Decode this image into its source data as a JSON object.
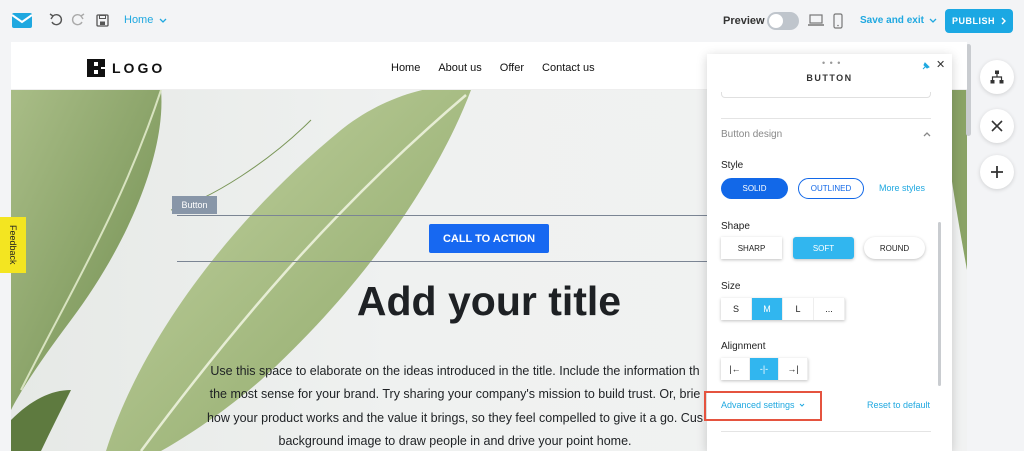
{
  "toolbar": {
    "page_selector": "Home",
    "preview_label": "Preview",
    "save_exit_label": "Save and exit",
    "publish_label": "PUBLISH"
  },
  "site": {
    "logo_text": "LOGO",
    "nav": [
      "Home",
      "About us",
      "Offer",
      "Contact us"
    ],
    "selected_tag": "Button",
    "cta_label": "CALL TO ACTION",
    "title": "Add your title",
    "body_lines": [
      "Use this space to elaborate on the ideas introduced in the title. Include the information th",
      "the most sense for your brand. Try sharing your company's mission to build trust. Or, brie",
      "how your product works and the value it brings, so they feel compelled to give it a go. Cus",
      "background image to draw people in and drive your point home."
    ]
  },
  "feedback_label": "Feedback",
  "panel": {
    "drag_handle": "• • •",
    "title": "BUTTON",
    "section_title": "Button design",
    "style_label": "Style",
    "style_options": [
      "SOLID",
      "OUTLINED"
    ],
    "more_styles": "More styles",
    "shape_label": "Shape",
    "shape_options": [
      "SHARP",
      "SOFT",
      "ROUND"
    ],
    "size_label": "Size",
    "size_options": [
      "S",
      "M",
      "L",
      "..."
    ],
    "alignment_label": "Alignment",
    "alignment_options": [
      "|←",
      "-|-",
      "→|"
    ],
    "advanced_settings": "Advanced settings",
    "reset_default": "Reset to default"
  },
  "colors": {
    "accent": "#1fa8e0",
    "cta_blue": "#1768f1",
    "highlight_red": "#e5533f",
    "feedback_yellow": "#f3e521"
  }
}
